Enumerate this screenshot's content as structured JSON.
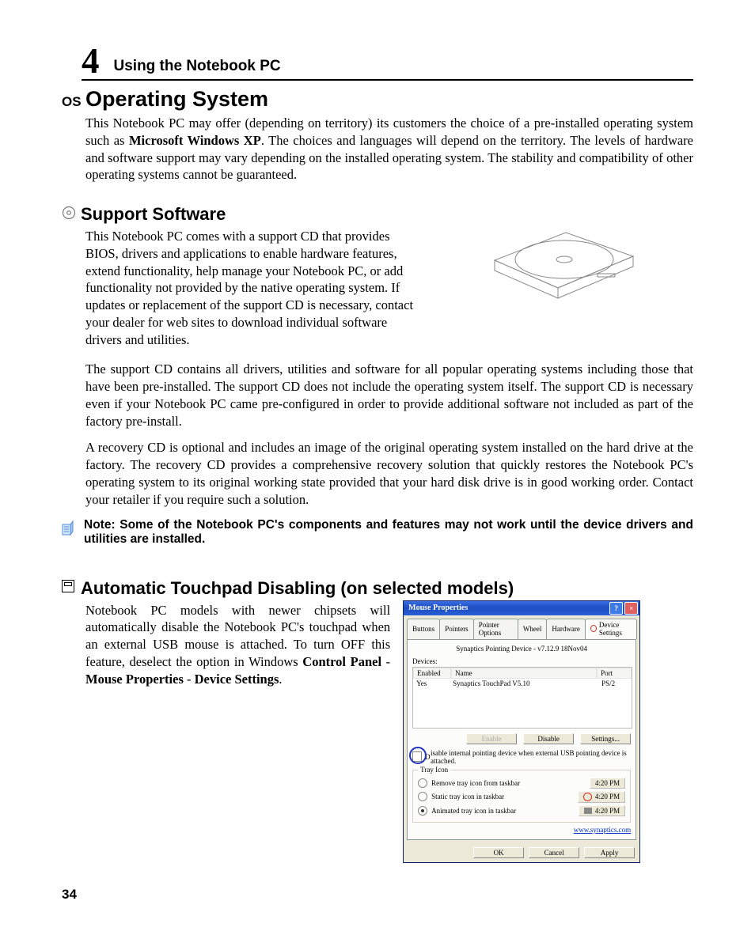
{
  "chapter": {
    "number": "4",
    "title": "Using the Notebook PC"
  },
  "h1": {
    "prefix": "OS",
    "text": "Operating System"
  },
  "p1a": "This Notebook PC may offer (depending on territory) its customers the choice of a pre-installed operating system such as ",
  "p1b": "Microsoft Windows XP",
  "p1c": ". The choices and languages will depend on the territory. The levels of hardware and software support may vary depending on the installed operating system. The stability and compatibility of other operating systems cannot be guaranteed.",
  "h2a": "Support Software",
  "p2": "This Notebook PC comes with a support CD that provides BIOS, drivers and applications to enable hardware features, extend functionality, help manage your Notebook PC, or add functionality not provided by the native operating system. If updates or replacement of the support CD is necessary, contact your dealer for web sites to download individual software drivers and utilities.",
  "p3": "The support CD contains all drivers, utilities and software for all popular operating systems including those that have been pre-installed. The support CD does not include the operating system itself. The support CD is necessary even if your Notebook PC came pre-configured in order to provide additional software not included as part of the factory pre-install.",
  "p4": "A recovery CD is optional and includes an image of the original operating system installed on the hard drive at the factory. The recovery CD provides a comprehensive recovery solution that quickly restores the Notebook PC's operating system to its original working state provided that your hard disk drive is in good working order. Contact your retailer if you require such a solution.",
  "note": "Note: Some of the Notebook PC's components and features may not work until the device drivers and utilities are installed.",
  "h2b": "Automatic Touchpad Disabling (on selected models)",
  "p5a": "Notebook PC models with newer chipsets will automatically disable the Notebook PC's touchpad when an external USB mouse is attached. To turn OFF this feature, deselect the option in Windows ",
  "p5b": "Control Panel",
  "p5c": " - ",
  "p5d": "Mouse Properties",
  "p5e": " - ",
  "p5f": "Device Settings",
  "p5g": ".",
  "dialog": {
    "title": "Mouse Properties",
    "tabs": [
      "Buttons",
      "Pointers",
      "Pointer Options",
      "Wheel",
      "Hardware",
      "Device Settings"
    ],
    "version": "Synaptics Pointing Device - v7.12.9 18Nov04",
    "devices_label": "Devices:",
    "col1": "Enabled",
    "col2": "Name",
    "col3": "Port",
    "row1c1": "Yes",
    "row1c2": "Synaptics TouchPad V5.10",
    "row1c3": "PS/2",
    "enable": "Enable",
    "disable": "Disable",
    "settings": "Settings...",
    "checkbox": "isable internal pointing device when external USB pointing device is attached.",
    "tray_legend": "Tray Icon",
    "r1": "Remove tray icon from taskbar",
    "r2": "Static tray icon in taskbar",
    "r3": "Animated tray icon in taskbar",
    "time": "4:20 PM",
    "link": "www.synaptics.com",
    "ok": "OK",
    "cancel": "Cancel",
    "apply": "Apply"
  },
  "page_number": "34"
}
